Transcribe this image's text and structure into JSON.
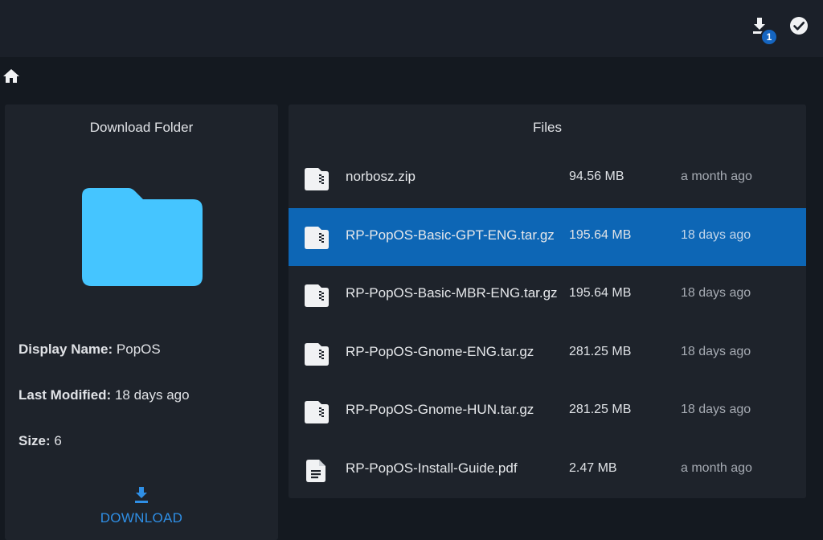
{
  "topbar": {
    "download_badge": "1"
  },
  "left_panel": {
    "title": "Download Folder",
    "display_name_label": "Display Name:",
    "display_name": "PopOS",
    "last_modified_label": "Last Modified:",
    "last_modified": "18 days ago",
    "size_label": "Size:",
    "size": "6",
    "download_label": "DOWNLOAD"
  },
  "files_panel": {
    "title": "Files",
    "files": [
      {
        "name": "norbosz.zip",
        "size": "94.56 MB",
        "modified": "a month ago",
        "type": "archive"
      },
      {
        "name": "RP-PopOS-Basic-GPT-ENG.tar.gz",
        "size": "195.64 MB",
        "modified": "18 days ago",
        "type": "archive"
      },
      {
        "name": "RP-PopOS-Basic-MBR-ENG.tar.gz",
        "size": "195.64 MB",
        "modified": "18 days ago",
        "type": "archive"
      },
      {
        "name": "RP-PopOS-Gnome-ENG.tar.gz",
        "size": "281.25 MB",
        "modified": "18 days ago",
        "type": "archive"
      },
      {
        "name": "RP-PopOS-Gnome-HUN.tar.gz",
        "size": "281.25 MB",
        "modified": "18 days ago",
        "type": "archive"
      },
      {
        "name": "RP-PopOS-Install-Guide.pdf",
        "size": "2.47 MB",
        "modified": "a month ago",
        "type": "document"
      }
    ]
  },
  "colors": {
    "accent": "#0d66b5",
    "folder": "#45c5ff",
    "link": "#2f8fe6"
  }
}
